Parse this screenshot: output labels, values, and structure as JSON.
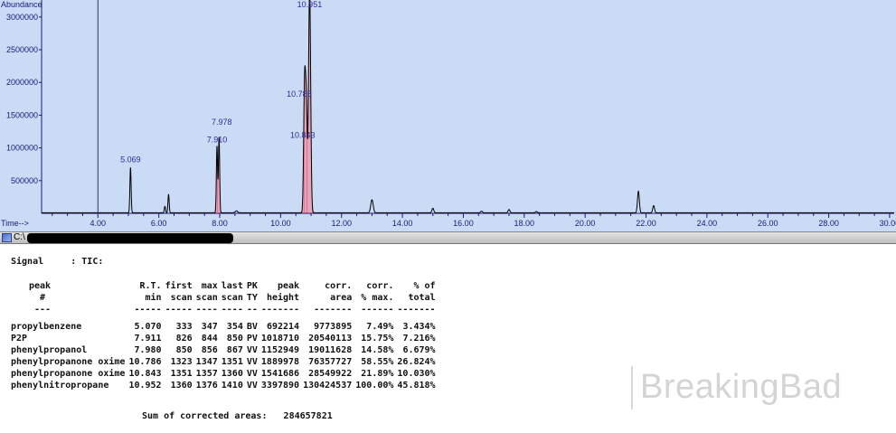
{
  "chart_data": {
    "type": "line",
    "ylabel": "Abundance",
    "xlabel": "Time-->",
    "xlim": [
      2.15,
      30.15
    ],
    "ylim": [
      0,
      3260000
    ],
    "y_ticks": [
      500000,
      1000000,
      1500000,
      2000000,
      2500000,
      3000000
    ],
    "y_tick_labels": [
      "500000",
      "1000000",
      "1500000",
      "2000000",
      "2500000",
      "3000000"
    ],
    "x_ticks": [
      4,
      6,
      8,
      10,
      12,
      14,
      16,
      18,
      20,
      22,
      24,
      26,
      28,
      30
    ],
    "x_tick_labels": [
      "4.00",
      "6.00",
      "8.00",
      "10.00",
      "12.00",
      "14.00",
      "16.00",
      "18.00",
      "20.00",
      "22.00",
      "24.00",
      "26.00",
      "28.00",
      "30.00"
    ],
    "cursor_x": 4.0,
    "baseline": 8000,
    "peaks": [
      {
        "rt": 5.07,
        "height": 692214,
        "width": 0.02,
        "label": "5.069",
        "integrated": false
      },
      {
        "rt": 6.2,
        "height": 100000,
        "width": 0.02,
        "integrated": false
      },
      {
        "rt": 6.32,
        "height": 280000,
        "width": 0.02,
        "integrated": false
      },
      {
        "rt": 7.91,
        "height": 1018710,
        "width": 0.02,
        "label": "7.910",
        "integrated": true
      },
      {
        "rt": 7.978,
        "height": 1152949,
        "width": 0.02,
        "label": "7.978",
        "integrated": true
      },
      {
        "rt": 8.55,
        "height": 30000,
        "width": 0.04,
        "integrated": false
      },
      {
        "rt": 10.786,
        "height": 1889978,
        "width": 0.03,
        "label": "10.785",
        "integrated": true
      },
      {
        "rt": 10.843,
        "height": 1541686,
        "width": 0.03,
        "label": "10.843",
        "integrated": true
      },
      {
        "rt": 10.952,
        "height": 3397890,
        "width": 0.035,
        "label": "10.951",
        "integrated": true
      },
      {
        "rt": 13.0,
        "height": 200000,
        "width": 0.04,
        "integrated": false
      },
      {
        "rt": 15.0,
        "height": 70000,
        "width": 0.03,
        "integrated": false
      },
      {
        "rt": 16.6,
        "height": 25000,
        "width": 0.03,
        "integrated": false
      },
      {
        "rt": 17.5,
        "height": 50000,
        "width": 0.03,
        "integrated": false
      },
      {
        "rt": 18.4,
        "height": 20000,
        "width": 0.03,
        "integrated": false
      },
      {
        "rt": 21.75,
        "height": 330000,
        "width": 0.03,
        "integrated": false
      },
      {
        "rt": 22.25,
        "height": 110000,
        "width": 0.03,
        "integrated": false
      }
    ]
  },
  "window": {
    "path": "C:\\"
  },
  "report": {
    "signal_label": "Signal",
    "signal_value": ": TIC:",
    "headers_row1": [
      "peak",
      "R.T.",
      "first",
      "max",
      "last",
      "PK",
      "peak",
      "corr.",
      "corr.",
      "% of"
    ],
    "headers_row2": [
      "#",
      "min",
      "scan",
      "scan",
      "scan",
      "TY",
      "height",
      "area",
      "% max.",
      "total"
    ],
    "dashes": [
      "---",
      "-----",
      "-----",
      "----",
      "----",
      "--",
      "-------",
      "-------",
      "------",
      "-------"
    ],
    "rows": [
      [
        "propylbenzene",
        "5.070",
        "333",
        "347",
        "354",
        "BV",
        "692214",
        "9773895",
        "7.49%",
        "3.434%"
      ],
      [
        "P2P",
        "7.911",
        "826",
        "844",
        "850",
        "PV",
        "1018710",
        "20540113",
        "15.75%",
        "7.216%"
      ],
      [
        "phenylpropanol",
        "7.980",
        "850",
        "856",
        "867",
        "VV",
        "1152949",
        "19011628",
        "14.58%",
        "6.679%"
      ],
      [
        "phenylpropanone oxime",
        "10.786",
        "1323",
        "1347",
        "1351",
        "VV",
        "1889978",
        "76357727",
        "58.55%",
        "26.824%"
      ],
      [
        "phenylpropanone oxime",
        "10.843",
        "1351",
        "1357",
        "1360",
        "VV",
        "1541686",
        "28549922",
        "21.89%",
        "10.030%"
      ],
      [
        "phenylnitropropane",
        "10.952",
        "1360",
        "1376",
        "1410",
        "VV",
        "3397890",
        "130424537",
        "100.00%",
        "45.818%"
      ]
    ],
    "sum_label": "Sum of corrected areas:",
    "sum_value": "284657821"
  },
  "watermark": {
    "text": "BreakingBad"
  }
}
